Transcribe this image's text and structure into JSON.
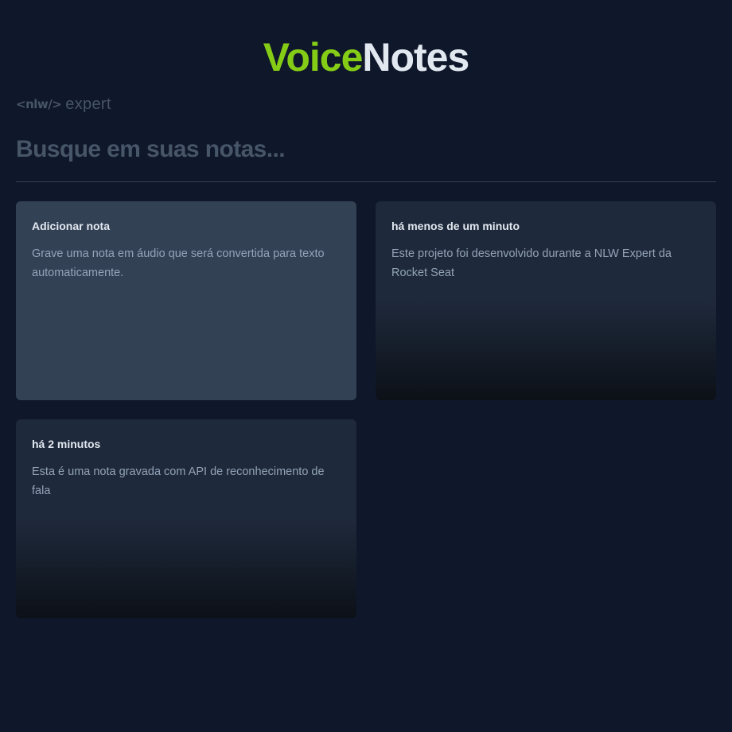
{
  "header": {
    "title_part1": "Voice",
    "title_part2": "Notes",
    "logo_nlw": "<nlw/>",
    "logo_expert": "expert"
  },
  "search": {
    "placeholder": "Busque em suas notas...",
    "value": ""
  },
  "cards": [
    {
      "type": "add",
      "title": "Adicionar nota",
      "body": "Grave uma nota em áudio que será convertida para texto automaticamente."
    },
    {
      "type": "note",
      "title": "há menos de um minuto",
      "body": "Este projeto foi desenvolvido durante a NLW Expert da Rocket Seat"
    },
    {
      "type": "note",
      "title": "há 2 minutos",
      "body": "Esta é uma nota gravada com API de reconhecimento de fala"
    }
  ],
  "colors": {
    "background": "#0f172a",
    "accent": "#84cc16",
    "card_add": "#334155",
    "card_note": "#1e293b"
  }
}
